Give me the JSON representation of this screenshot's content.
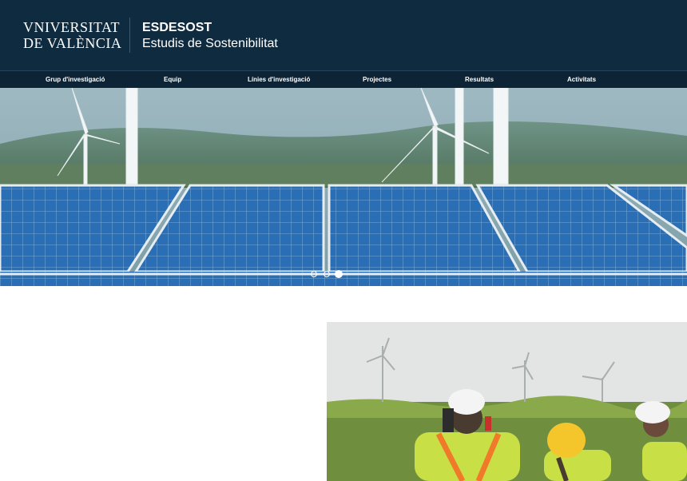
{
  "header": {
    "logo_line1": "VNIVERSITAT",
    "logo_line2": "DE VALÈNCIA",
    "site_title": "ESDESOST",
    "site_subtitle": "Estudis de Sostenibilitat"
  },
  "nav": {
    "items": [
      {
        "label": "Grup d'investigació"
      },
      {
        "label": "Equip"
      },
      {
        "label": "Línies d'investigació"
      },
      {
        "label": "Projectes"
      },
      {
        "label": "Resultats"
      },
      {
        "label": "Activitats"
      }
    ]
  },
  "carousel": {
    "slide_count": 3,
    "active_index": 2
  },
  "colors": {
    "header_bg": "#0f2b40",
    "nav_bg": "#0d2436",
    "panel_blue": "#1e5fa0"
  }
}
